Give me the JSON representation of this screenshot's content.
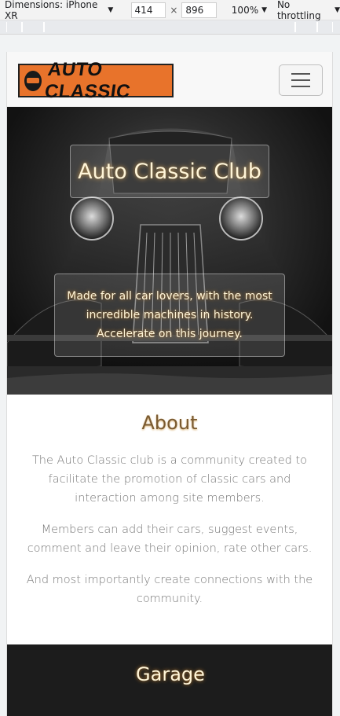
{
  "devtools": {
    "device": "Dimensions: iPhone XR",
    "width": "414",
    "height": "896",
    "zoom": "100%",
    "throttling": "No throttling"
  },
  "navbar": {
    "logo_text": "AUTO CLASSIC",
    "toggler_icon": "hamburger-icon"
  },
  "hero": {
    "title": "Auto Classic Club",
    "subtitle": "Made for all car lovers, with the most incredible machines in history. Accelerate on this journey."
  },
  "about": {
    "heading": "About",
    "paragraphs": [
      "The Auto Classic club is a community created to facilitate the promotion of classic cars and interaction among site members.",
      "Members can add their cars, suggest events, comment and leave their opinion, rate other cars.",
      "And most importantly create connections with the community."
    ]
  },
  "garage": {
    "heading": "Garage"
  },
  "colors": {
    "logo_bg": "#e8732b",
    "heading_gold": "#7a5a30",
    "dark_section": "#1c1c1c"
  }
}
